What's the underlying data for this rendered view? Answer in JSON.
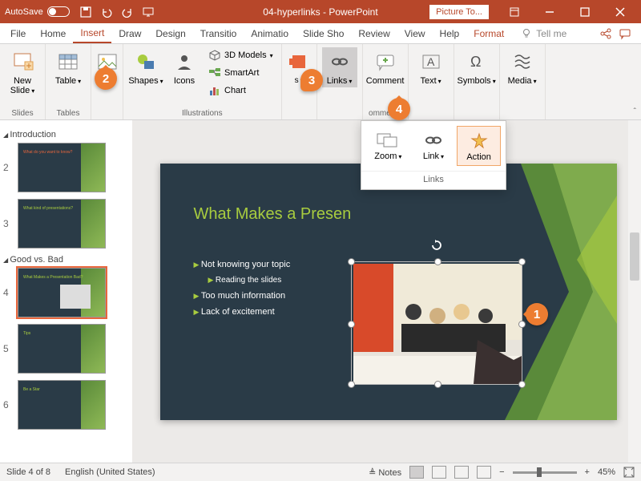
{
  "titlebar": {
    "autosave_label": "AutoSave",
    "autosave_state": "Off",
    "document_title": "04-hyperlinks - PowerPoint",
    "picture_tools": "Picture To..."
  },
  "tabs": {
    "file": "File",
    "home": "Home",
    "insert": "Insert",
    "draw": "Draw",
    "design": "Design",
    "transitions": "Transitio",
    "animations": "Animatio",
    "slideshow": "Slide Sho",
    "review": "Review",
    "view": "View",
    "help": "Help",
    "format": "Format",
    "tellme": "Tell me"
  },
  "ribbon": {
    "new_slide": "New Slide",
    "slides_group": "Slides",
    "table": "Table",
    "tables_group": "Tables",
    "images": "ges",
    "shapes": "Shapes",
    "icons": "Icons",
    "models3d": "3D Models",
    "smartart": "SmartArt",
    "chart": "Chart",
    "illustrations_group": "Illustrations",
    "links": "Links",
    "comment": "Comment",
    "comments_group": "omments",
    "text": "Text",
    "symbols": "Symbols",
    "media": "Media"
  },
  "links_popup": {
    "zoom": "Zoom",
    "link": "Link",
    "action": "Action",
    "group_label": "Links"
  },
  "thumbs": {
    "section1": "Introduction",
    "section2": "Good vs. Bad",
    "slides": [
      "2",
      "3",
      "4",
      "5",
      "6"
    ]
  },
  "slide": {
    "title": "What Makes a Presen",
    "bullets": [
      "Not knowing your topic",
      "Reading the slides",
      "Too much information",
      "Lack of excitement"
    ]
  },
  "markers": {
    "m1": "1",
    "m2": "2",
    "m3": "3",
    "m4": "4"
  },
  "statusbar": {
    "slide_info": "Slide 4 of 8",
    "language": "English (United States)",
    "notes": "Notes",
    "zoom": "45%"
  }
}
